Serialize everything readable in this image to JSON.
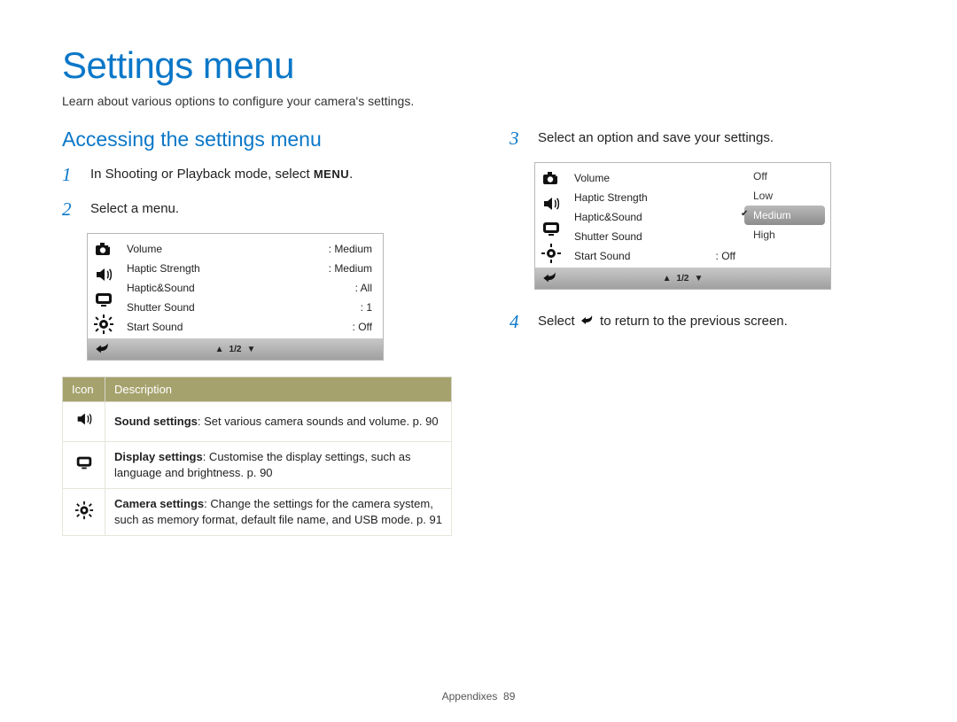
{
  "title": "Settings menu",
  "intro": "Learn about various options to configure your camera's settings.",
  "left": {
    "subtitle": "Accessing the settings menu",
    "step1_pre": "In Shooting or Playback mode, select ",
    "step1_menu": "MENU",
    "step1_post": ".",
    "step2": "Select a menu.",
    "screen1": {
      "rows": [
        {
          "label": "Volume",
          "value": "Medium"
        },
        {
          "label": "Haptic Strength",
          "value": "Medium"
        },
        {
          "label": "Haptic&Sound",
          "value": "All"
        },
        {
          "label": "Shutter Sound",
          "value": "1"
        },
        {
          "label": "Start Sound",
          "value": "Off"
        }
      ],
      "pager": "1/2"
    },
    "table_headers": {
      "icon": "Icon",
      "desc": "Description"
    },
    "table_rows": [
      {
        "icon": "sound",
        "bold": "Sound settings",
        "rest": ": Set various camera sounds and volume. p. 90"
      },
      {
        "icon": "display",
        "bold": "Display settings",
        "rest": ": Customise the display settings, such as language and brightness. p. 90"
      },
      {
        "icon": "gear",
        "bold": "Camera settings",
        "rest": ": Change the settings for the camera system, such as memory format, default file name, and USB mode. p. 91"
      }
    ]
  },
  "right": {
    "step3": "Select an option and save your settings.",
    "screen2": {
      "rows": [
        {
          "label": "Volume"
        },
        {
          "label": "Haptic Strength"
        },
        {
          "label": "Haptic&Sound"
        },
        {
          "label": "Shutter Sound"
        },
        {
          "label": "Start Sound",
          "value": "Off"
        }
      ],
      "options": [
        "Off",
        "Low",
        "Medium",
        "High"
      ],
      "selected": "Medium",
      "pager": "1/2"
    },
    "step4_pre": "Select ",
    "step4_post": " to return to the previous screen."
  },
  "footer": {
    "section": "Appendixes",
    "page": "89"
  }
}
